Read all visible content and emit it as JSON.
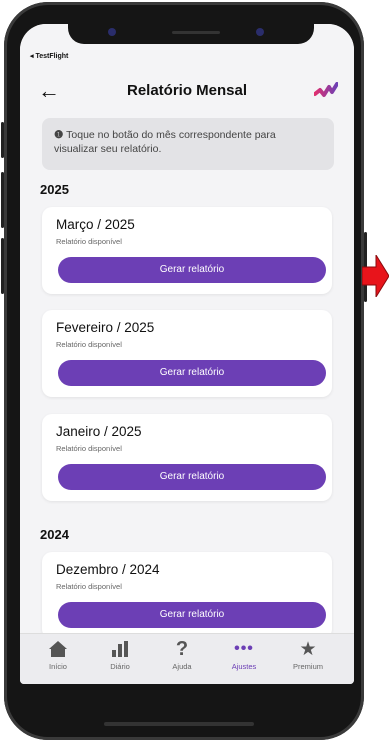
{
  "status": {
    "back_app": "◂ TestFlight"
  },
  "header": {
    "title": "Relatório Mensal"
  },
  "info": {
    "icon": "info-icon",
    "text": "Toque no botão do mês correspondente para visualizar seu relatório."
  },
  "sections": [
    {
      "year": "2025",
      "cards": [
        {
          "title": "Março / 2025",
          "subtitle": "Relatório disponível",
          "button": "Gerar relatório"
        },
        {
          "title": "Fevereiro / 2025",
          "subtitle": "Relatório disponível",
          "button": "Gerar relatório"
        },
        {
          "title": "Janeiro / 2025",
          "subtitle": "Relatório disponível",
          "button": "Gerar relatório"
        }
      ]
    },
    {
      "year": "2024",
      "cards": [
        {
          "title": "Dezembro / 2024",
          "subtitle": "Relatório disponível",
          "button": "Gerar relatório"
        }
      ]
    }
  ],
  "tabs": [
    {
      "label": "Início",
      "icon": "home-icon",
      "active": false
    },
    {
      "label": "Diário",
      "icon": "bar-chart-icon",
      "active": false
    },
    {
      "label": "Ajuda",
      "icon": "question-icon",
      "active": false
    },
    {
      "label": "Ajustes",
      "icon": "more-icon",
      "active": true
    },
    {
      "label": "Premium",
      "icon": "star-icon",
      "active": false
    }
  ],
  "colors": {
    "accent": "#6c3fb5",
    "arrow": "#e8141b"
  }
}
